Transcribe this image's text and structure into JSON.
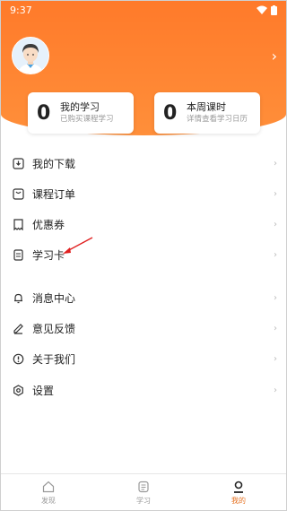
{
  "status": {
    "time": "9:37"
  },
  "stats": [
    {
      "num": "0",
      "title": "我的学习",
      "sub": "已购买课程学习"
    },
    {
      "num": "0",
      "title": "本周课时",
      "sub": "详情查看学习日历"
    }
  ],
  "menu": [
    {
      "label": "我的下载",
      "icon": "download-icon"
    },
    {
      "label": "课程订单",
      "icon": "order-icon"
    },
    {
      "label": "优惠券",
      "icon": "coupon-icon"
    },
    {
      "label": "学习卡",
      "icon": "study-card-icon"
    },
    {
      "label": "消息中心",
      "icon": "bell-icon"
    },
    {
      "label": "意见反馈",
      "icon": "feedback-icon"
    },
    {
      "label": "关于我们",
      "icon": "info-icon"
    },
    {
      "label": "设置",
      "icon": "gear-icon"
    }
  ],
  "tabs": [
    {
      "label": "发现",
      "icon": "home-icon"
    },
    {
      "label": "学习",
      "icon": "learn-icon"
    },
    {
      "label": "我的",
      "icon": "profile-icon"
    }
  ],
  "colors": {
    "accent": "#ff7a2a",
    "active_tab": "#e5701f",
    "annotation": "#e02020"
  }
}
